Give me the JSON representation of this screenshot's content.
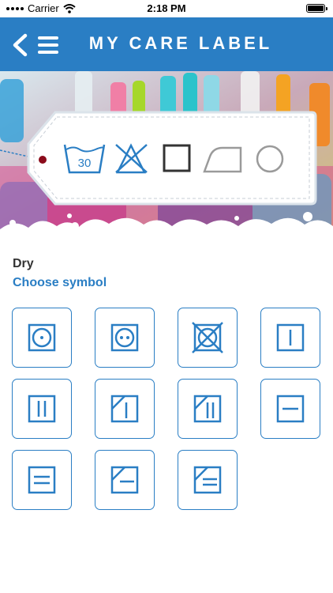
{
  "status_bar": {
    "carrier": "Carrier",
    "time": "2:18 PM"
  },
  "header": {
    "title": "MY CARE LABEL"
  },
  "label": {
    "slots": [
      "wash-30-icon",
      "no-bleach-icon",
      "dry-square-icon",
      "iron-icon",
      "dry-clean-circle-icon"
    ]
  },
  "section": {
    "category": "Dry",
    "prompt": "Choose symbol"
  },
  "symbols": [
    "tumble-dry-low-icon",
    "tumble-dry-medium-icon",
    "do-not-tumble-dry-icon",
    "line-dry-icon",
    "drip-dry-icon",
    "line-dry-shade-icon",
    "drip-dry-shade-icon",
    "dry-flat-icon",
    "wet-flat-dry-icon",
    "dry-flat-shade-icon",
    "wet-flat-dry-shade-icon"
  ],
  "colors": {
    "brand_blue": "#2a7ec4",
    "tag_red": "#8b0b1b"
  }
}
